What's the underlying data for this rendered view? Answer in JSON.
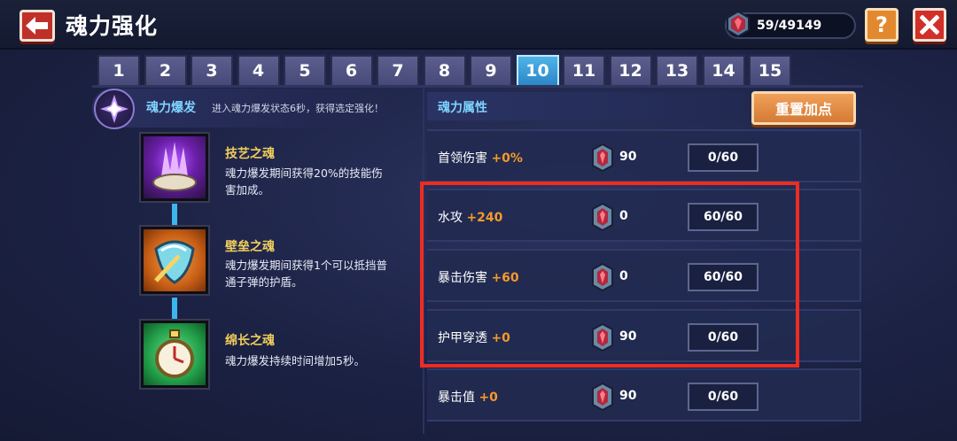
{
  "header": {
    "title": "魂力强化",
    "currency_value": "59/49149",
    "help_label": "?"
  },
  "tabs": [
    "1",
    "2",
    "3",
    "4",
    "5",
    "6",
    "7",
    "8",
    "9",
    "10",
    "11",
    "12",
    "13",
    "14",
    "15"
  ],
  "active_tab": "10",
  "burst": {
    "name": "魂力爆发",
    "description": "进入魂力爆发状态6秒，获得选定强化！"
  },
  "skills": [
    {
      "name": "技艺之魂",
      "desc_line1": "魂力爆发期间获得20%的技能伤",
      "desc_line2": "害加成。",
      "icon": "purple-crystal-icon"
    },
    {
      "name": "壁垒之魂",
      "desc_line1": "魂力爆发期间获得1个可以抵挡普",
      "desc_line2": "通子弹的护盾。",
      "icon": "shield-icon"
    },
    {
      "name": "绵长之魂",
      "desc_line1": "魂力爆发持续时间增加5秒。",
      "desc_line2": "",
      "icon": "stopwatch-icon"
    }
  ],
  "attributes_panel": {
    "title": "魂力属性",
    "reset_label": "重置加点"
  },
  "attributes": [
    {
      "name": "首领伤害",
      "bonus": "+0%",
      "cost": "90",
      "level": "0/60"
    },
    {
      "name": "水攻",
      "bonus": "+240",
      "cost": "0",
      "level": "60/60"
    },
    {
      "name": "暴击伤害",
      "bonus": "+60",
      "cost": "0",
      "level": "60/60"
    },
    {
      "name": "护甲穿透",
      "bonus": "+0",
      "cost": "90",
      "level": "0/60"
    },
    {
      "name": "暴击值",
      "bonus": "+0",
      "cost": "90",
      "level": "0/60"
    }
  ],
  "colors": {
    "accent_blue": "#7fd3ff",
    "bonus_orange": "#f39a2c",
    "skill_name_gold": "#f0ce5c",
    "highlight_red": "#ee2c22"
  }
}
